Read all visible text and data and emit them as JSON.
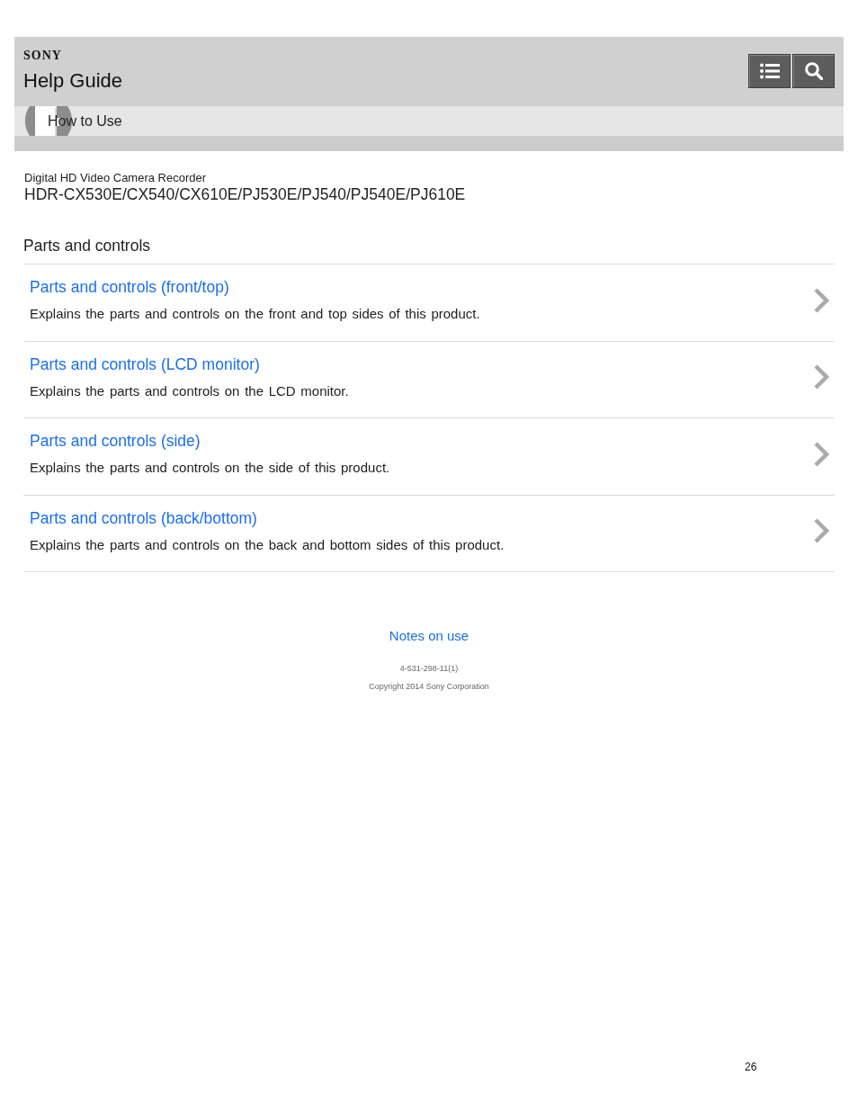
{
  "header": {
    "brand": "SONY",
    "title": "Help Guide"
  },
  "breadcrumb": {
    "label": "How to Use"
  },
  "product": {
    "category": "Digital HD Video Camera Recorder",
    "models": "HDR-CX530E/CX540/CX610E/PJ530E/PJ540/PJ540E/PJ610E"
  },
  "section": {
    "title": "Parts and controls",
    "items": [
      {
        "title": "Parts and controls (front/top)",
        "description": "Explains the parts and controls on the front and top sides of this product."
      },
      {
        "title": "Parts and controls (LCD monitor)",
        "description": "Explains the parts and controls on the LCD monitor."
      },
      {
        "title": "Parts and controls (side)",
        "description": "Explains the parts and controls on the side of this product."
      },
      {
        "title": "Parts and controls (back/bottom)",
        "description": "Explains the parts and controls on the back and bottom sides of this product."
      }
    ]
  },
  "footer": {
    "link": "Notes on use",
    "code": "4-531-298-11(1)",
    "copyright": "Copyright 2014 Sony Corporation"
  },
  "page_number": "26"
}
